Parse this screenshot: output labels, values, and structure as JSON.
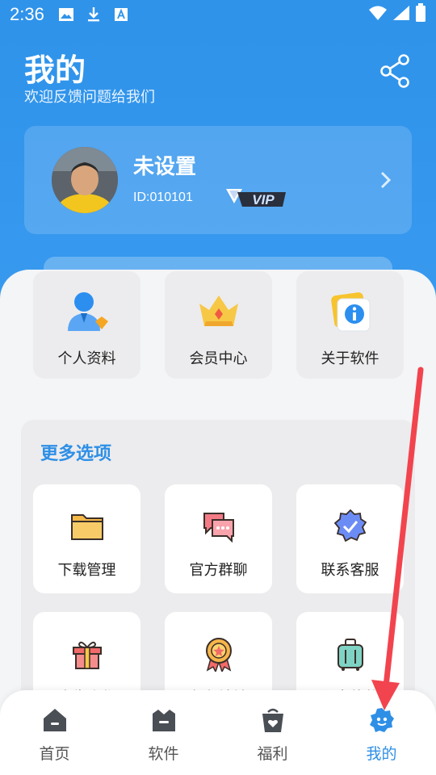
{
  "status_bar": {
    "time": "2:36"
  },
  "header": {
    "title": "我的",
    "subtitle": "欢迎反馈问题给我们"
  },
  "profile": {
    "name": "未设置",
    "id_text": "ID:010101",
    "vip_label": "VIP"
  },
  "top_tiles": [
    {
      "label": "个人资料",
      "icon": "user-icon"
    },
    {
      "label": "会员中心",
      "icon": "crown-icon"
    },
    {
      "label": "关于软件",
      "icon": "info-icon"
    }
  ],
  "more": {
    "title": "更多选项",
    "items": [
      {
        "label": "下载管理",
        "icon": "folder-icon"
      },
      {
        "label": "官方群聊",
        "icon": "chat-icon"
      },
      {
        "label": "联系客服",
        "icon": "badge-check-icon"
      },
      {
        "label": "广告合作",
        "icon": "gift-icon"
      },
      {
        "label": "永久地址",
        "icon": "medal-icon"
      },
      {
        "label": "分享软件",
        "icon": "suitcase-icon"
      }
    ]
  },
  "bottom_nav": [
    {
      "label": "首页",
      "icon": "home-icon",
      "active": false
    },
    {
      "label": "软件",
      "icon": "app-icon",
      "active": false
    },
    {
      "label": "福利",
      "icon": "bag-icon",
      "active": false
    },
    {
      "label": "我的",
      "icon": "profile-face-icon",
      "active": true
    }
  ],
  "colors": {
    "primary": "#2f93ea",
    "active": "#2e8fe6",
    "annotation_arrow": "#f2444e"
  }
}
